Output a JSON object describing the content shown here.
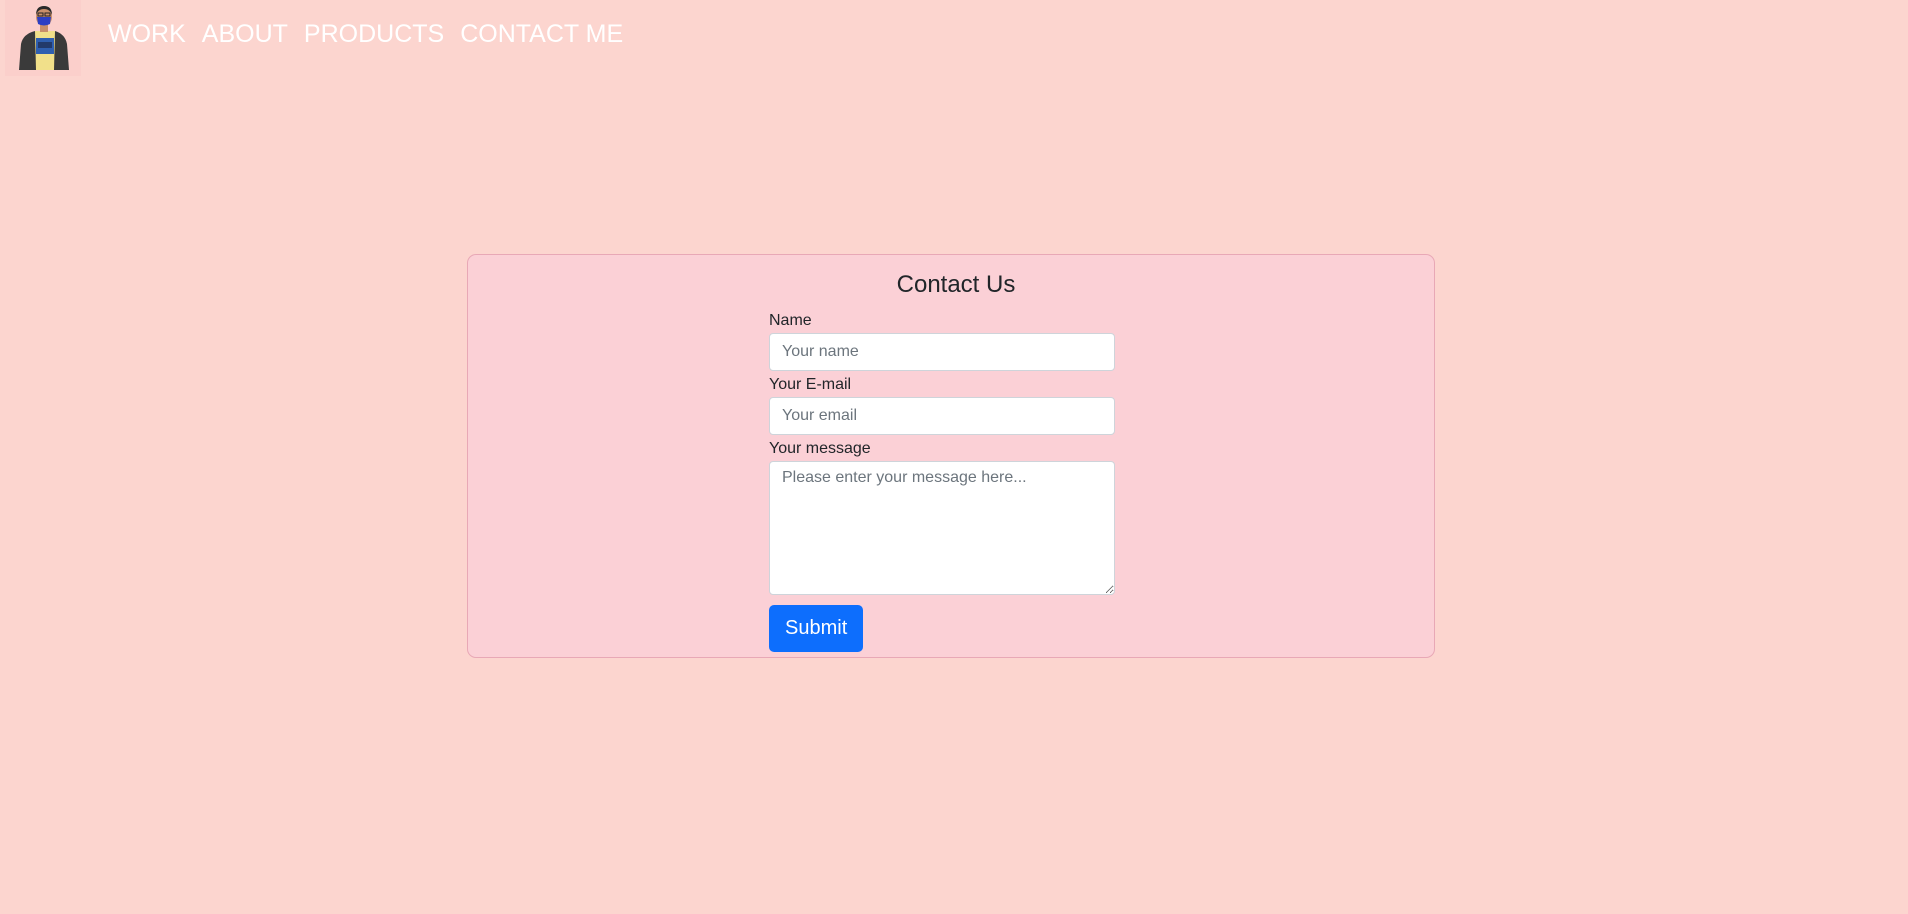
{
  "nav": {
    "links": [
      "WORK",
      "ABOUT",
      "PRODUCTS",
      "CONTACT ME"
    ]
  },
  "contact": {
    "title": "Contact Us",
    "name_label": "Name",
    "name_placeholder": "Your name",
    "email_label": "Your E-mail",
    "email_placeholder": "Your email",
    "message_label": "Your message",
    "message_placeholder": "Please enter your message here...",
    "submit_label": "Submit"
  },
  "colors": {
    "page_background": "#fcd5cf",
    "card_background": "#fbd0d6",
    "card_border": "#e8a8b6",
    "nav_text": "#ffffff",
    "submit_button": "#0d6efd"
  }
}
